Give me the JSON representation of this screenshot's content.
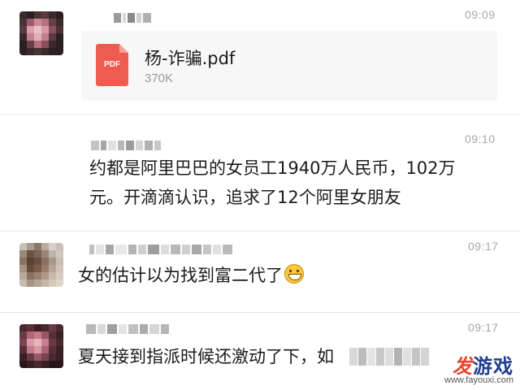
{
  "messages": [
    {
      "time": "09:09",
      "file": {
        "name": "杨-诈骗.pdf",
        "size": "370K",
        "icon_label": "PDF"
      }
    },
    {
      "time": "09:10",
      "line1": "约都是阿里巴巴的女员工1940万人民币，102万",
      "line2": "元。开滴滴认识，追求了12个阿里女朋友"
    },
    {
      "time": "09:17",
      "text": "女的估计以为找到富二代了"
    },
    {
      "time": "09:17",
      "text": "夏天接到指派时候还激动了下，如"
    }
  ],
  "watermark": {
    "logo_accent": "发",
    "logo_rest": "游戏",
    "url": "www.fayouxi.com"
  },
  "colors": {
    "pdf_red": "#ee5b51",
    "time_gray": "#a6a6a6",
    "file_card_bg": "#f7f7f7"
  }
}
